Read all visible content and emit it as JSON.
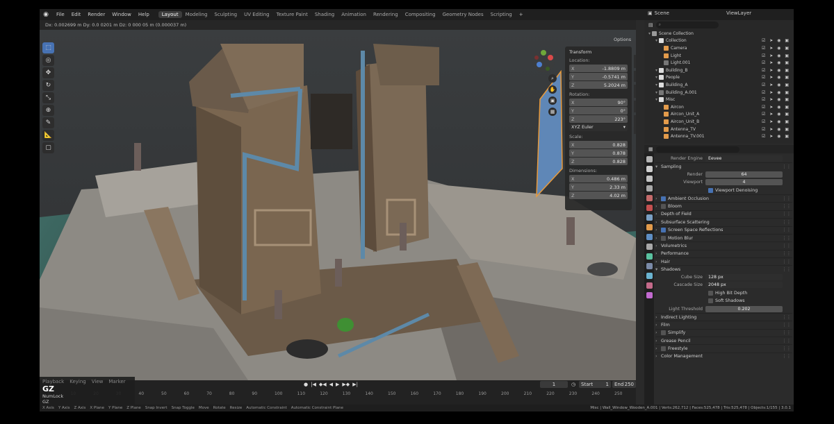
{
  "topbar": {
    "menu": [
      "File",
      "Edit",
      "Render",
      "Window",
      "Help"
    ],
    "workspaces": [
      "Layout",
      "Modeling",
      "Sculpting",
      "UV Editing",
      "Texture Paint",
      "Shading",
      "Animation",
      "Rendering",
      "Compositing",
      "Geometry Nodes",
      "Scripting"
    ],
    "active_workspace": "Layout",
    "plus": "+",
    "scene": "Scene",
    "view_layer": "ViewLayer"
  },
  "viewport": {
    "header_text": "Dx: 0.002699 m   Dy: 0.0 0201 m   Dz: 0 000 05 m (0.000037 m)",
    "options_label": "Options",
    "tools": [
      "select-tool",
      "cursor-tool",
      "move-tool",
      "rotate-tool",
      "scale-tool",
      "transform-tool",
      "annotate-tool",
      "measure-tool",
      "add-cube-tool"
    ]
  },
  "npanel": {
    "title": "Transform",
    "location_label": "Location:",
    "location": [
      {
        "k": "X",
        "v": "-1.8809 m"
      },
      {
        "k": "Y",
        "v": "-0.5741 m"
      },
      {
        "k": "Z",
        "v": "5.2024 m"
      }
    ],
    "rotation_label": "Rotation:",
    "rotation": [
      {
        "k": "X",
        "v": "90°"
      },
      {
        "k": "Y",
        "v": "0°"
      },
      {
        "k": "Z",
        "v": "223°"
      }
    ],
    "rotation_mode": "XYZ Euler",
    "scale_label": "Scale:",
    "scale": [
      {
        "k": "X",
        "v": "0.828"
      },
      {
        "k": "Y",
        "v": "0.878"
      },
      {
        "k": "Z",
        "v": "0.828"
      }
    ],
    "dimensions_label": "Dimensions:",
    "dimensions": [
      {
        "k": "X",
        "v": "0.486 m"
      },
      {
        "k": "Y",
        "v": "2.33 m"
      },
      {
        "k": "Z",
        "v": "4.02 m"
      }
    ],
    "side_tabs": [
      "Item",
      "Tool",
      "View",
      "Edit",
      "Trim UV"
    ]
  },
  "timeline": {
    "current_frame": "1",
    "start_label": "Start",
    "start": "1",
    "end_label": "End",
    "end": "250",
    "ticks": [
      "0",
      "10",
      "20",
      "30",
      "40",
      "50",
      "60",
      "70",
      "80",
      "90",
      "100",
      "110",
      "120",
      "130",
      "140",
      "150",
      "160",
      "170",
      "180",
      "190",
      "200",
      "210",
      "220",
      "230",
      "240",
      "250"
    ]
  },
  "keybox": {
    "menu": [
      "Playback",
      "Keying",
      "View",
      "Marker"
    ],
    "key": "GZ",
    "numlock": "NumLock",
    "last": "GZ"
  },
  "status": {
    "items": [
      "X Axis",
      "Y Axis",
      "Z Axis",
      "X Plane",
      "Y Plane",
      "Z Plane",
      "Snap Invert",
      "Snap Toggle",
      "Move",
      "Rotate",
      "Resize",
      "Automatic Constraint",
      "Automatic Constraint Plane"
    ],
    "right": "Misc | Wall_Window_Wooden_A.001 | Verts:262,712 | Faces:525,478 | Tris:525,478 | Objects:1/155 | 3.0.1"
  },
  "outliner": {
    "search_placeholder": "",
    "rows": [
      {
        "name": "Scene Collection",
        "indent": 0,
        "color": "#9a9a9a"
      },
      {
        "name": "Collection",
        "indent": 1,
        "color": "#dcdcdc"
      },
      {
        "name": "Camera",
        "indent": 2,
        "color": "#e39b4b"
      },
      {
        "name": "Light",
        "indent": 2,
        "color": "#e39b4b"
      },
      {
        "name": "Light.001",
        "indent": 2,
        "color": "#777777"
      },
      {
        "name": "Building_B",
        "indent": 1,
        "color": "#dcdcdc"
      },
      {
        "name": "People",
        "indent": 1,
        "color": "#dcdcdc"
      },
      {
        "name": "Building_A",
        "indent": 1,
        "color": "#dcdcdc"
      },
      {
        "name": "Building_A.001",
        "indent": 1,
        "color": "#777777"
      },
      {
        "name": "Misc",
        "indent": 1,
        "color": "#dcdcdc"
      },
      {
        "name": "Aircon",
        "indent": 2,
        "color": "#e39b4b"
      },
      {
        "name": "Aircon_Unit_A",
        "indent": 2,
        "color": "#e39b4b"
      },
      {
        "name": "Aircon_Unit_B",
        "indent": 2,
        "color": "#e39b4b"
      },
      {
        "name": "Antenna_TV",
        "indent": 2,
        "color": "#e39b4b"
      },
      {
        "name": "Antenna_TV.001",
        "indent": 2,
        "color": "#e39b4b"
      }
    ]
  },
  "properties": {
    "render_engine_label": "Render Engine",
    "render_engine": "Eevee",
    "sampling": "Sampling",
    "render_label": "Render",
    "render_samples": "64",
    "viewport_label": "Viewport",
    "viewport_samples": "4",
    "viewport_denoising": "Viewport Denoising",
    "panels": [
      {
        "name": "Ambient Occlusion",
        "check": true
      },
      {
        "name": "Bloom",
        "check": false
      },
      {
        "name": "Depth of Field",
        "check": null
      },
      {
        "name": "Subsurface Scattering",
        "check": null
      },
      {
        "name": "Screen Space Reflections",
        "check": true
      },
      {
        "name": "Motion Blur",
        "check": false
      },
      {
        "name": "Volumetrics",
        "check": null
      },
      {
        "name": "Performance",
        "check": null
      },
      {
        "name": "Hair",
        "check": null
      }
    ],
    "shadows": "Shadows",
    "cube_size_label": "Cube Size",
    "cube_size": "128 px",
    "cascade_size_label": "Cascade Size",
    "cascade_size": "2048 px",
    "high_bit_depth": "High Bit Depth",
    "soft_shadows": "Soft Shadows",
    "light_threshold_label": "Light Threshold",
    "light_threshold": "0.202",
    "panels2": [
      {
        "name": "Indirect Lighting",
        "check": null
      },
      {
        "name": "Film",
        "check": null
      },
      {
        "name": "Simplify",
        "check": false
      },
      {
        "name": "Grease Pencil",
        "check": null
      },
      {
        "name": "Freestyle",
        "check": false
      },
      {
        "name": "Color Management",
        "check": null
      }
    ]
  },
  "colors": {
    "accent": "#4772b3",
    "bg": "#2a2a2a",
    "header": "#1f1f1f"
  }
}
